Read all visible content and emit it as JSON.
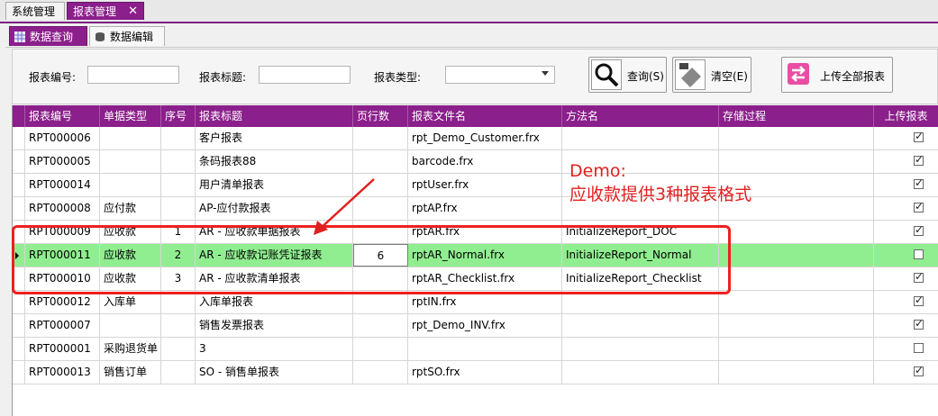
{
  "outer_tabs": [
    "系统管理",
    "报表管理"
  ],
  "close_glyph": "✕",
  "inner_tabs": [
    "数据查询",
    "数据编辑"
  ],
  "filters": {
    "code_label": "报表编号:",
    "title_label": "报表标题:",
    "type_label": "报表类型:"
  },
  "buttons": {
    "query": "查询(S)",
    "clear": "清空(E)",
    "upload": "上传全部报表"
  },
  "columns": [
    "报表编号",
    "单据类型",
    "序号",
    "报表标题",
    "页行数",
    "报表文件名",
    "方法名",
    "存储过程",
    "上传报表"
  ],
  "rows": [
    {
      "code": "RPT000006",
      "type": "",
      "seq": "",
      "title": "客户报表",
      "lines": "",
      "file": "rpt_Demo_Customer.frx",
      "method": "",
      "proc": "",
      "upload": true
    },
    {
      "code": "RPT000005",
      "type": "",
      "seq": "",
      "title": "条码报表88",
      "lines": "",
      "file": "barcode.frx",
      "method": "",
      "proc": "",
      "upload": true
    },
    {
      "code": "RPT000014",
      "type": "",
      "seq": "",
      "title": "用户清单报表",
      "lines": "",
      "file": "rptUser.frx",
      "method": "",
      "proc": "",
      "upload": true
    },
    {
      "code": "RPT000008",
      "type": "应付款",
      "seq": "",
      "title": "AP-应付款报表",
      "lines": "",
      "file": "rptAP.frx",
      "method": "",
      "proc": "",
      "upload": true
    },
    {
      "code": "RPT000009",
      "type": "应收款",
      "seq": "1",
      "title": "AR - 应收款单据报表",
      "lines": "",
      "file": "rptAR.frx",
      "method": "InitializeReport_DOC",
      "proc": "",
      "upload": true
    },
    {
      "code": "RPT000011",
      "type": "应收款",
      "seq": "2",
      "title": "AR - 应收款记账凭证报表",
      "lines": "6",
      "file": "rptAR_Normal.frx",
      "method": "InitializeReport_Normal",
      "proc": "",
      "upload": false
    },
    {
      "code": "RPT000010",
      "type": "应收款",
      "seq": "3",
      "title": "AR - 应收款清单报表",
      "lines": "",
      "file": "rptAR_Checklist.frx",
      "method": "InitializeReport_Checklist",
      "proc": "",
      "upload": true
    },
    {
      "code": "RPT000012",
      "type": "入库单",
      "seq": "",
      "title": "入库单报表",
      "lines": "",
      "file": "rptIN.frx",
      "method": "",
      "proc": "",
      "upload": true
    },
    {
      "code": "RPT000007",
      "type": "",
      "seq": "",
      "title": "销售发票报表",
      "lines": "",
      "file": "rpt_Demo_INV.frx",
      "method": "",
      "proc": "",
      "upload": true
    },
    {
      "code": "RPT000001",
      "type": "采购退货单",
      "seq": "",
      "title": "3",
      "lines": "",
      "file": "",
      "method": "",
      "proc": "",
      "upload": false
    },
    {
      "code": "RPT000013",
      "type": "销售订单",
      "seq": "",
      "title": "SO - 销售单报表",
      "lines": "",
      "file": "rptSO.frx",
      "method": "",
      "proc": "",
      "upload": true
    }
  ],
  "annotation": {
    "line1": "Demo:",
    "line2": "应收款提供3种报表格式"
  },
  "colors": {
    "accent": "#8b1f8b",
    "selected_row": "#90ee90",
    "annotation": "#e02020"
  }
}
